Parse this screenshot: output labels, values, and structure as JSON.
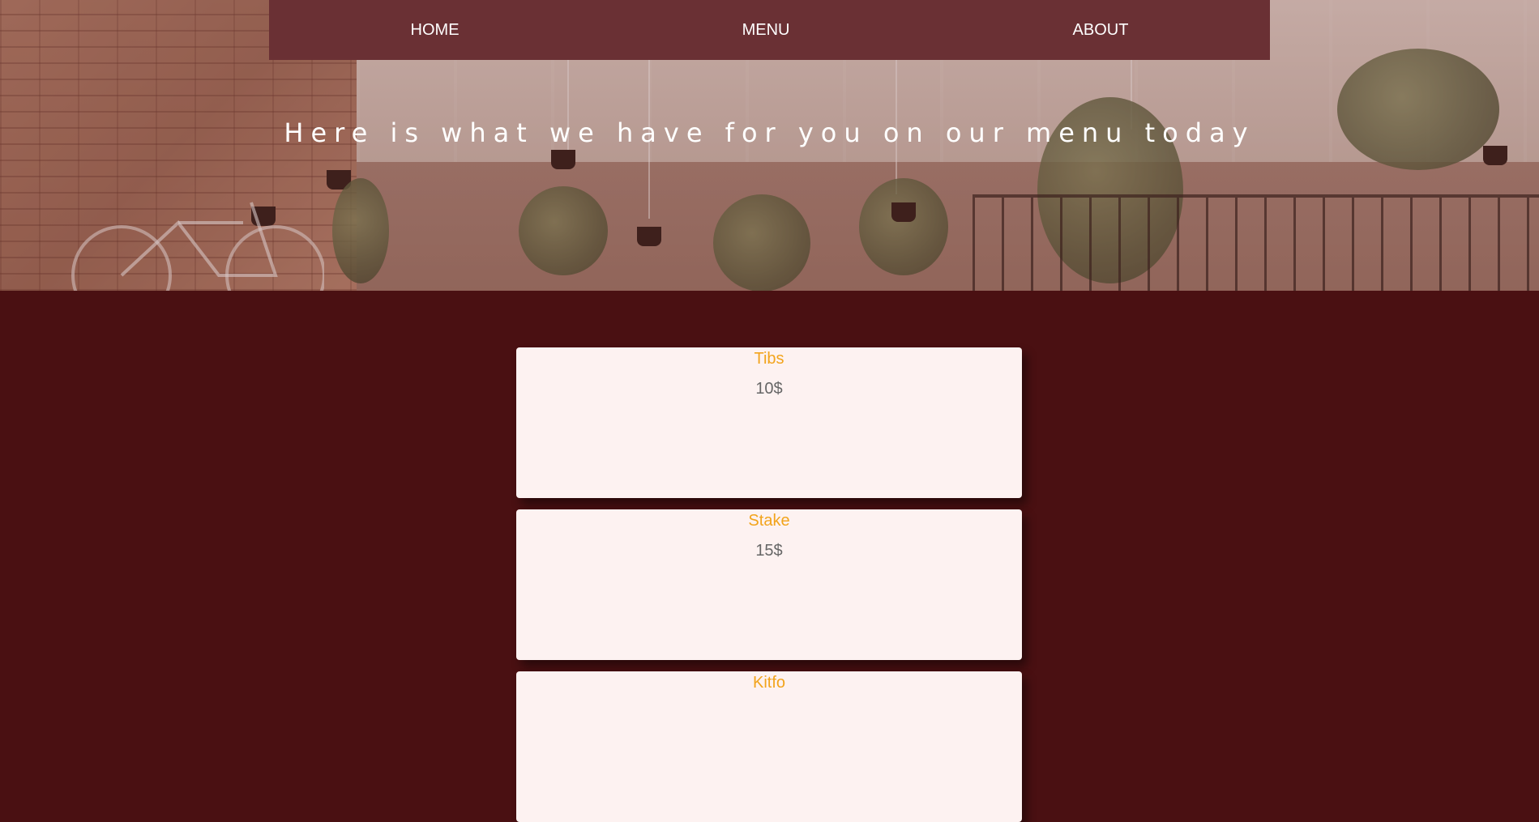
{
  "nav": {
    "items": [
      {
        "label": "HOME"
      },
      {
        "label": "MENU"
      },
      {
        "label": "ABOUT"
      }
    ]
  },
  "hero": {
    "title": "Here is what we have for you on our menu today"
  },
  "menu": {
    "items": [
      {
        "name": "Tibs",
        "price": "10$"
      },
      {
        "name": "Stake",
        "price": "15$"
      },
      {
        "name": "Kitfo",
        "price": ""
      }
    ]
  },
  "colors": {
    "navbar": "#6a3034",
    "section_bg": "#4a1012",
    "card_bg": "#fdf2f1",
    "item_name": "#f2a41c",
    "item_price": "#666666"
  }
}
